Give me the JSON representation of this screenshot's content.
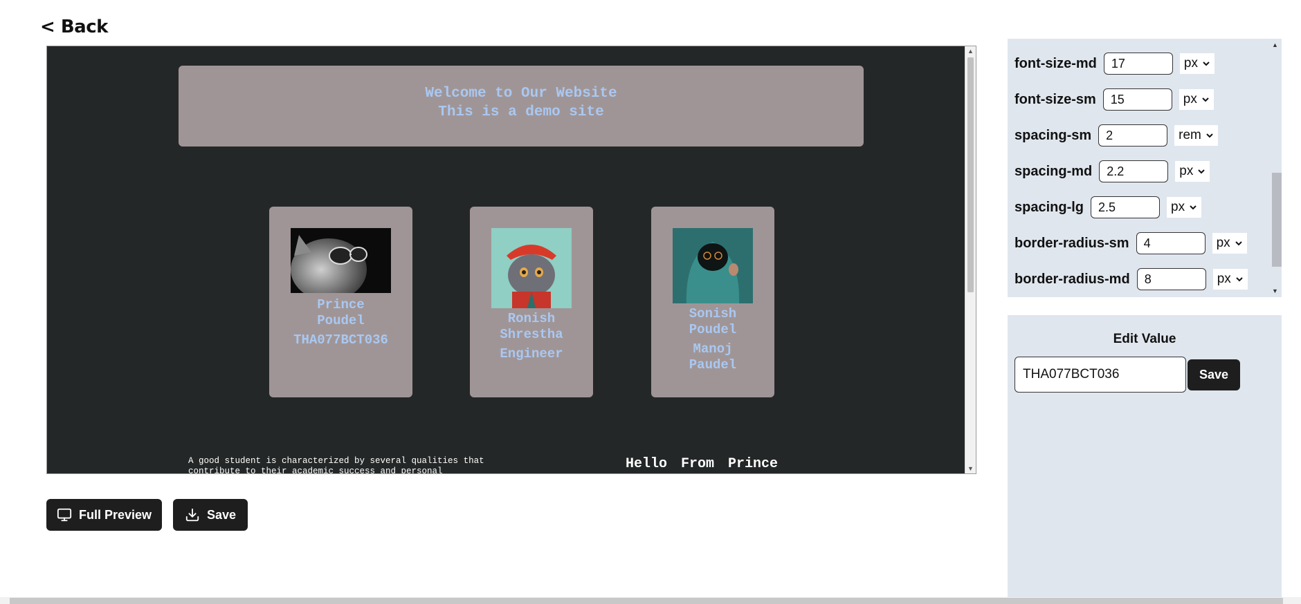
{
  "nav": {
    "back_label": "< Back"
  },
  "preview": {
    "hero_line1": "Welcome to Our Website",
    "hero_line2": "This is a demo site",
    "cards": [
      {
        "name_line1": "Prince",
        "name_line2": "Poudel",
        "sub": "THA077BCT036",
        "image": "cat-with-sunglasses-photo"
      },
      {
        "name_line1": "Ronish",
        "name_line2": "Shrestha",
        "sub": "Engineer",
        "image": "cat-in-red-hat-photo"
      },
      {
        "name_line1": "Sonish",
        "name_line2": "Poudel",
        "sub_line1": "Manoj",
        "sub_line2": "Paudel",
        "image": "hooded-figure-photo"
      }
    ],
    "footer_text": "A good student is characterized by several qualities that contribute to their academic success and personal",
    "hello_text": "Hello From Prince",
    "colors": {
      "background": "#242727",
      "card": "#a09596",
      "card_text": "#a9c8f2"
    }
  },
  "actions": {
    "full_preview_label": "Full Preview",
    "save_label": "Save"
  },
  "properties": [
    {
      "label": "font-size-md",
      "value": "17",
      "unit": "px"
    },
    {
      "label": "font-size-sm",
      "value": "15",
      "unit": "px"
    },
    {
      "label": "spacing-sm",
      "value": "2",
      "unit": "rem"
    },
    {
      "label": "spacing-md",
      "value": "2.2",
      "unit": "px"
    },
    {
      "label": "spacing-lg",
      "value": "2.5",
      "unit": "px"
    },
    {
      "label": "border-radius-sm",
      "value": "4",
      "unit": "px"
    },
    {
      "label": "border-radius-md",
      "value": "8",
      "unit": "px"
    }
  ],
  "edit": {
    "title": "Edit Value",
    "value": "THA077BCT036",
    "save_label": "Save"
  }
}
